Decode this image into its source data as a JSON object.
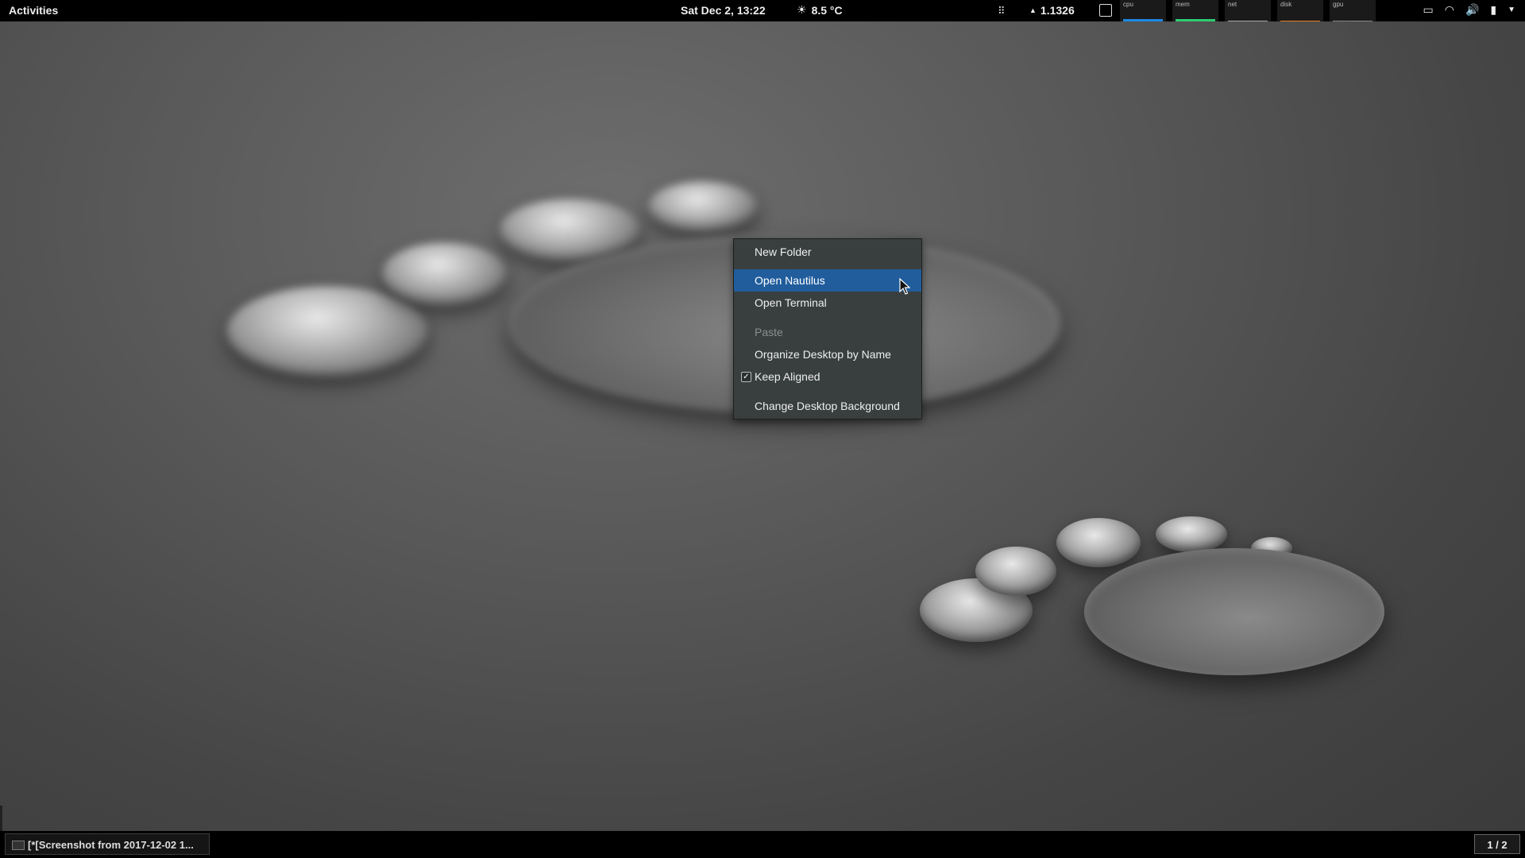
{
  "topbar": {
    "activities": "Activities",
    "clock": "Sat Dec  2, 13:22",
    "weather": "8.5 °C",
    "weather_icon": "sun-icon",
    "rate": "1.1326",
    "graphs": [
      {
        "label": "cpu",
        "color": "#1e88e5"
      },
      {
        "label": "mem",
        "color": "#2ecc71"
      },
      {
        "label": "net",
        "color": "#aaaaaa"
      },
      {
        "label": "disk",
        "color": "#e67e22"
      },
      {
        "label": "gpu",
        "color": "#888888"
      }
    ],
    "tray_icons": [
      "display-icon",
      "wifi-icon",
      "volume-icon",
      "battery-icon",
      "dropdown-arrow-icon"
    ]
  },
  "context_menu": {
    "items": [
      {
        "label": "New Folder",
        "state": "normal"
      },
      {
        "label": "Open Nautilus",
        "state": "highlighted"
      },
      {
        "label": "Open Terminal",
        "state": "normal"
      },
      {
        "label": "Paste",
        "state": "disabled"
      },
      {
        "label": "Organize Desktop by Name",
        "state": "normal"
      },
      {
        "label": "Keep Aligned",
        "state": "checked"
      },
      {
        "label": "Change Desktop Background",
        "state": "normal"
      }
    ]
  },
  "bottombar": {
    "task_title": "[*[Screenshot from 2017-12-02 1...",
    "workspace": "1 / 2"
  },
  "colors": {
    "highlight": "#215d9c",
    "menu_bg": "#393f3f"
  }
}
